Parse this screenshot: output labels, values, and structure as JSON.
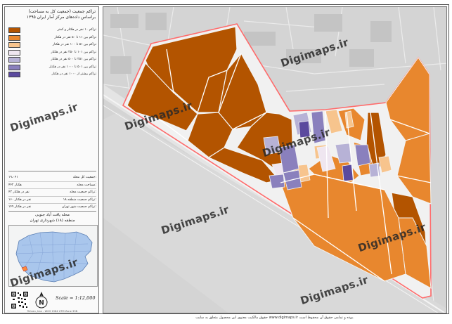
{
  "panel": {
    "title_line1": "تراکم جمعیت (جمعیت کل به مساحت)",
    "title_line2": "براساس داده‌های مرکز آمار ایران ۱۳۹۵"
  },
  "legend": [
    {
      "label": "تراکم ۱۰ نفر در هکتار و کمتر",
      "color": "#b35400"
    },
    {
      "label": "تراکم بین ۱۱ تا ۵۰ نفر در هکتار",
      "color": "#e8872e"
    },
    {
      "label": "تراکم بین ۵۱ تا ۱۰۰ نفر در هکتار",
      "color": "#f7c48d"
    },
    {
      "label": "تراکم بین ۱۰۱ تا ۲۵۰ نفر در هکتار",
      "color": "#efe6f0"
    },
    {
      "label": "تراکم بین ۲۵۱ تا ۵۰۰ نفر در هکتار",
      "color": "#b7b2d6"
    },
    {
      "label": "تراکم بین ۵۰۱ تا ۱۰۰۰ نفر در هکتار",
      "color": "#8a80bd"
    },
    {
      "label": "تراکم بیشتر از ۱۰۰۰ نفر در هکتار",
      "color": "#5b4a9e"
    }
  ],
  "stats": [
    {
      "key": "جمعیت کل محله:",
      "value": "۱۹،۰۴۱"
    },
    {
      "key": "مساحت محله:",
      "value": "۴۴۲ هکتار"
    },
    {
      "key": "تراکم جمعیت محله:",
      "value": "۴۳ نفر در هکتار"
    },
    {
      "key": "تراکم جمعیت منطقه ۱۸:",
      "value": "۱۶۰ نفر در هکتار"
    },
    {
      "key": "تراکم جمعیت شهر تهران:",
      "value": "۱۴۹ نفر در هکتار"
    }
  ],
  "location": {
    "line1": "محله یافت آباد جنوبی",
    "line2": "منطقه (۱۸) شهرداری تهران"
  },
  "scale": "Scale = 1:12,000",
  "panel_footer": "Tehran, Iran - WGS 1984 UTM Zone 39N",
  "watermark": "Digimaps.ir",
  "footer": "حقوق مالکیت معنوی این محصول متعلق به سایت www.digimaps.ir بوده و تمامی حقوق آن محفوظ است.",
  "colors": {
    "road_gray": "#cfcfcf",
    "roads_white": "#e9e9e9",
    "boundary": "#ff6b6b"
  }
}
